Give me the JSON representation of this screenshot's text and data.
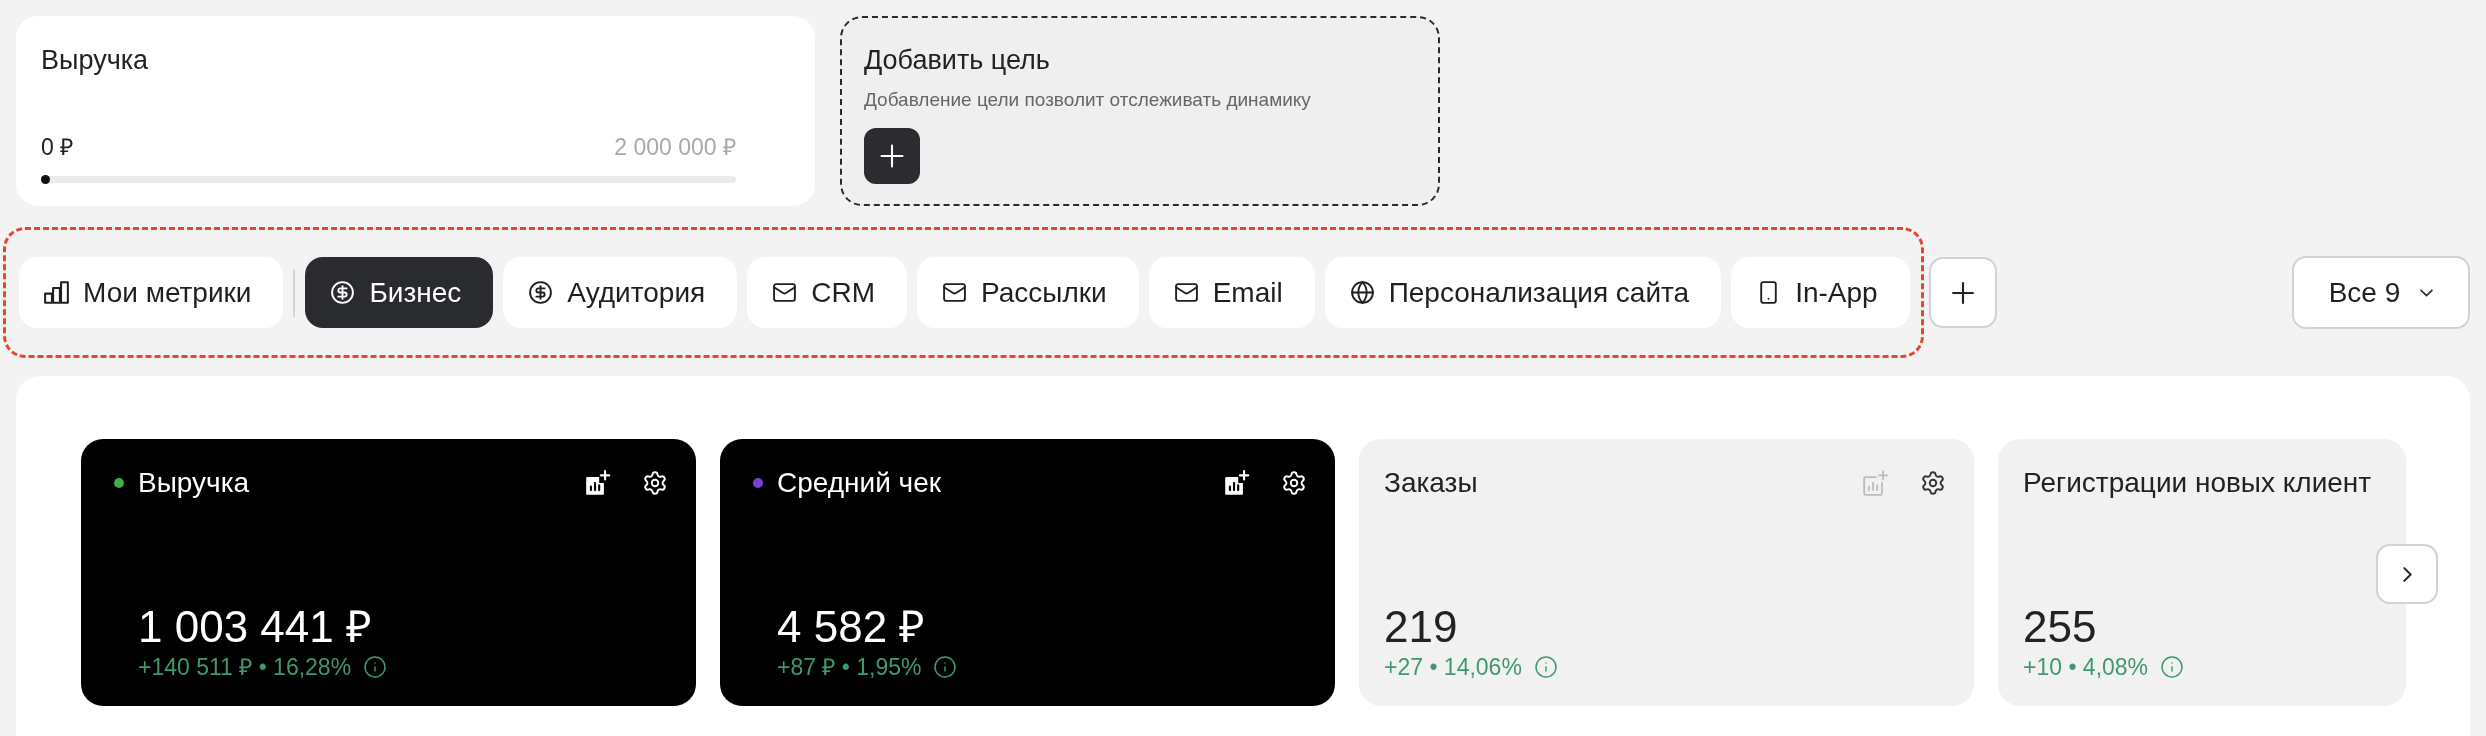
{
  "goal_card": {
    "title": "Выручка",
    "start": "0 ₽",
    "target": "2 000 000 ₽",
    "level": 0
  },
  "add_goal": {
    "title": "Добавить цель",
    "subtitle": "Добавление цели позволит отслеживать динамику"
  },
  "tabs": [
    {
      "label": "Мои метрики",
      "kind": "metrics",
      "selected": false
    },
    {
      "label": "Бизнес",
      "kind": "money",
      "selected": true
    },
    {
      "label": "Аудитория",
      "kind": "money",
      "selected": false
    },
    {
      "label": "CRM",
      "kind": "mail",
      "selected": false
    },
    {
      "label": "Рассылки",
      "kind": "mail",
      "selected": false
    },
    {
      "label": "Email",
      "kind": "mail",
      "selected": false
    },
    {
      "label": "Персонализация сайта",
      "kind": "web",
      "selected": false
    },
    {
      "label": "In-App",
      "kind": "mobile",
      "selected": false
    }
  ],
  "filter": {
    "label": "Все 9"
  },
  "metric_cards": [
    {
      "title": "Выручка",
      "selected": true,
      "color": "#3fae49",
      "value": "1 003 441 ₽",
      "change": "+140 511 ₽ • 16,28%",
      "actions": {
        "chart_disabled": false
      }
    },
    {
      "title": "Средний чек",
      "selected": true,
      "color": "#7a3fd0",
      "value": "4 582 ₽",
      "change": "+87 ₽ • 1,95%",
      "actions": {
        "chart_disabled": false
      }
    },
    {
      "title": "Заказы",
      "selected": false,
      "value": "219",
      "change": "+27 • 14,06%",
      "actions": {
        "chart_disabled": true
      }
    },
    {
      "title": "Регистрации новых клиент",
      "selected": false,
      "value": "255",
      "change": "+10 • 4,08%"
    }
  ]
}
